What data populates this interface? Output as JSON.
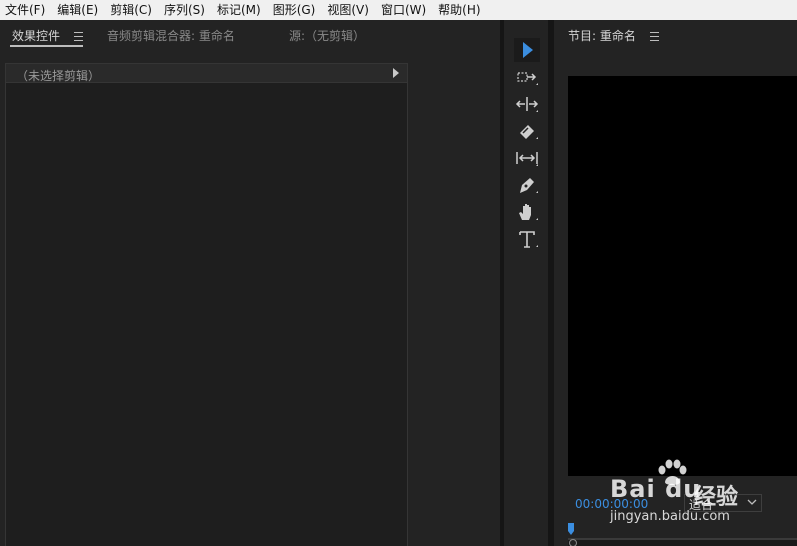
{
  "menubar": {
    "items": [
      "文件(F)",
      "编辑(E)",
      "剪辑(C)",
      "序列(S)",
      "标记(M)",
      "图形(G)",
      "视图(V)",
      "窗口(W)",
      "帮助(H)"
    ]
  },
  "left_panel": {
    "tabs": [
      {
        "label": "效果控件",
        "active": true
      },
      {
        "label": "音频剪辑混合器: 重命名",
        "active": false
      },
      {
        "label": "源:（无剪辑）",
        "active": false
      }
    ],
    "clip_header": "（未选择剪辑）"
  },
  "toolbar": {
    "tools": [
      {
        "name": "selection-tool",
        "icon": "arrow-pointer-icon",
        "selected": true
      },
      {
        "name": "track-select-forward-tool",
        "icon": "track-select-icon"
      },
      {
        "name": "ripple-edit-tool",
        "icon": "ripple-edit-icon"
      },
      {
        "name": "razor-tool",
        "icon": "razor-icon"
      },
      {
        "name": "slip-tool",
        "icon": "slip-icon"
      },
      {
        "name": "pen-tool",
        "icon": "pen-icon"
      },
      {
        "name": "hand-tool",
        "icon": "hand-icon"
      },
      {
        "name": "type-tool",
        "icon": "type-icon"
      }
    ],
    "accent": "#3b8ee0"
  },
  "program": {
    "title": "节目: 重命名",
    "timecode": "00:00:00:00",
    "fit": "适合"
  },
  "watermark": {
    "brand": "Bai du",
    "text": "经验",
    "url": "jingyan.baidu.com"
  },
  "colors": {
    "background": "#232323",
    "menubar": "#f0f0f0",
    "timecode": "#3b8ee0",
    "video": "#000000"
  }
}
